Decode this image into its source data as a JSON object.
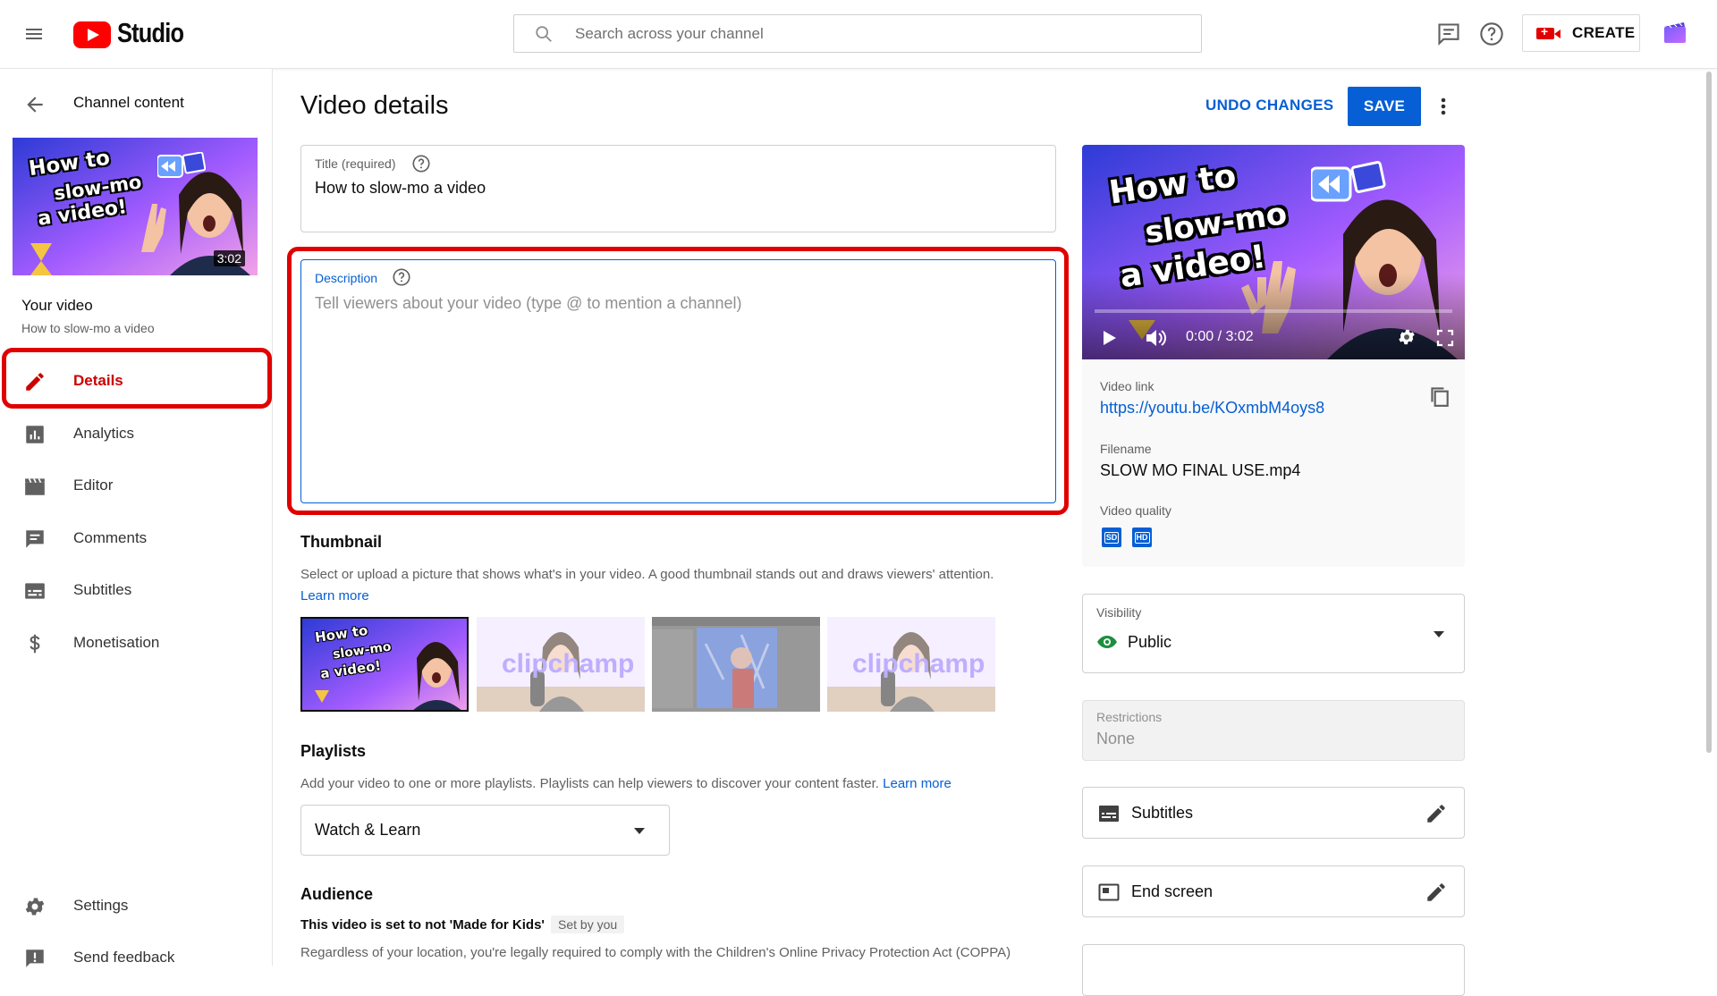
{
  "header": {
    "app_name": "Studio",
    "search_placeholder": "Search across your channel",
    "create_label": "CREATE"
  },
  "sidebar": {
    "back_title": "Channel content",
    "video_duration": "3:02",
    "thumb_text_line1": "How to",
    "thumb_text_line2": "slow-mo",
    "thumb_text_line3": "a video!",
    "your_video_label": "Your video",
    "video_title": "How to slow-mo a video",
    "items": [
      {
        "label": "Details",
        "icon": "pencil-icon",
        "active": true
      },
      {
        "label": "Analytics",
        "icon": "analytics-icon"
      },
      {
        "label": "Editor",
        "icon": "clapperboard-icon"
      },
      {
        "label": "Comments",
        "icon": "comment-icon"
      },
      {
        "label": "Subtitles",
        "icon": "subtitles-icon"
      },
      {
        "label": "Monetisation",
        "icon": "dollar-icon"
      }
    ],
    "settings_label": "Settings",
    "feedback_label": "Send feedback"
  },
  "main": {
    "page_title": "Video details",
    "undo_label": "UNDO CHANGES",
    "save_label": "SAVE",
    "title_field": {
      "label": "Title (required)",
      "value": "How to slow-mo a video"
    },
    "description_field": {
      "label": "Description",
      "placeholder": "Tell viewers about your video (type @ to mention a channel)"
    },
    "thumbnail": {
      "heading": "Thumbnail",
      "text": "Select or upload a picture that shows what's in your video. A good thumbnail stands out and draws viewers' attention.",
      "learn_more": "Learn more",
      "option_brand": "clipchamp"
    },
    "playlists": {
      "heading": "Playlists",
      "text": "Add your video to one or more playlists. Playlists can help viewers to discover your content faster.",
      "learn_more": "Learn more",
      "selected": "Watch & Learn"
    },
    "audience": {
      "heading": "Audience",
      "status": "This video is set to not 'Made for Kids'",
      "set_by": "Set by you",
      "text": "Regardless of your location, you're legally required to comply with the Children's Online Privacy Protection Act (COPPA)"
    }
  },
  "right": {
    "player": {
      "time": "0:00 / 3:02",
      "thumb_text_line1": "How to",
      "thumb_text_line2": "slow-mo",
      "thumb_text_line3": "a video!"
    },
    "video_link_label": "Video link",
    "video_link": "https://youtu.be/KOxmbM4oys8",
    "filename_label": "Filename",
    "filename": "SLOW MO FINAL USE.mp4",
    "quality_label": "Video quality",
    "quality_badges": [
      "SD",
      "HD"
    ],
    "visibility_label": "Visibility",
    "visibility_value": "Public",
    "restrictions_label": "Restrictions",
    "restrictions_value": "None",
    "subtitles_label": "Subtitles",
    "end_screen_label": "End screen"
  },
  "colors": {
    "accent_blue": "#065fd4",
    "brand_red": "#ff0000",
    "highlight_red": "#e00000",
    "public_green": "#1e8e3e"
  }
}
